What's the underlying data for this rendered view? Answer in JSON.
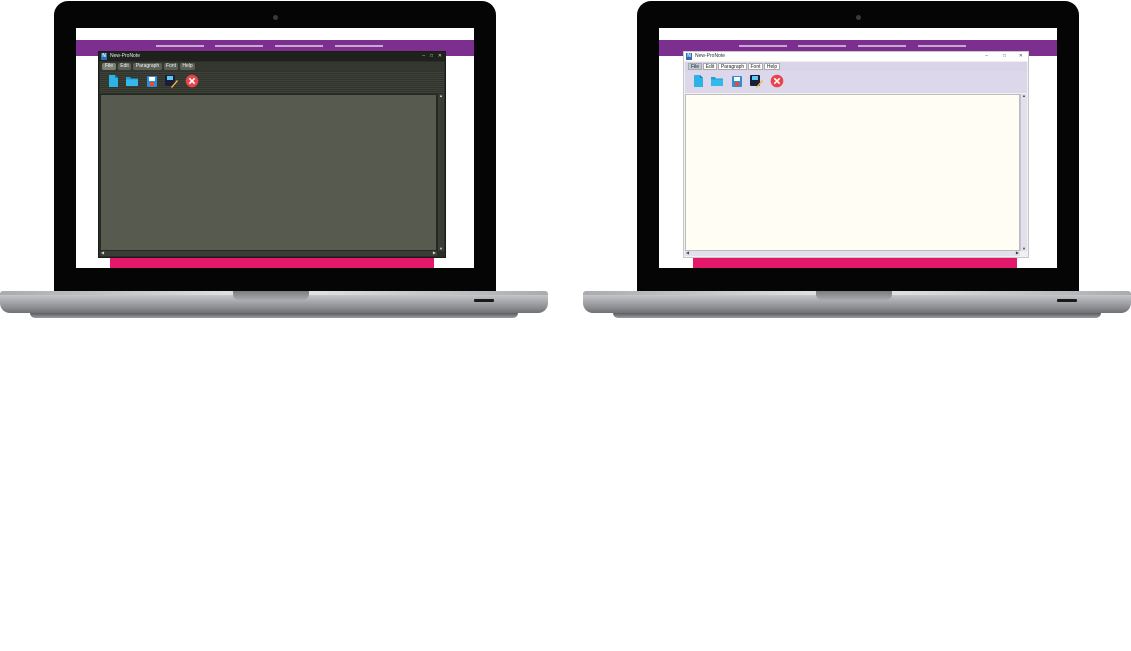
{
  "laptops": [
    {
      "theme": "dark",
      "window": {
        "title": "New-ProNote",
        "controls": [
          "–",
          "□",
          "✕"
        ],
        "menu": [
          "File",
          "Edit",
          "Paragraph",
          "Font",
          "Help"
        ],
        "toolbar_icons": [
          "new-document-icon",
          "open-folder-icon",
          "save-icon",
          "save-as-icon",
          "exit-icon"
        ]
      }
    },
    {
      "theme": "light",
      "window": {
        "title": "New-ProNote",
        "controls": [
          "–",
          "□",
          "✕"
        ],
        "menu": [
          "File",
          "Edit",
          "Paragraph",
          "Font",
          "Help"
        ],
        "toolbar_icons": [
          "new-document-icon",
          "open-folder-icon",
          "save-icon",
          "save-as-icon",
          "exit-icon"
        ]
      }
    }
  ],
  "colors": {
    "site_header": "#7c2f8e",
    "site_footer": "#e3186b",
    "dark_editor": "#565a4f",
    "light_editor": "#fffdf4"
  }
}
